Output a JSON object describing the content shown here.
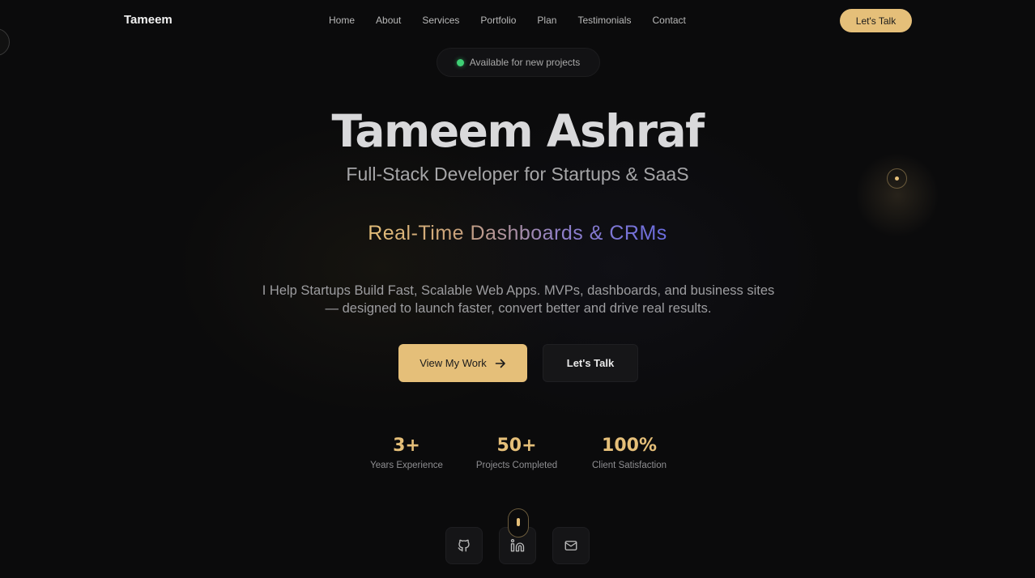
{
  "nav": {
    "brand": "Tameem",
    "links": [
      "Home",
      "About",
      "Services",
      "Portfolio",
      "Plan",
      "Testimonials",
      "Contact"
    ],
    "cta": "Let's Talk"
  },
  "availability": "Available for new projects",
  "hero": {
    "title": "Tameem Ashraf",
    "subtitle": "Full-Stack Developer for Startups & SaaS",
    "rotating_text": "Real-Time Dashboards & CRMs",
    "description": "I Help Startups Build Fast, Scalable Web Apps. MVPs, dashboards, and business sites — designed to launch faster, convert better and drive real results.",
    "primary_button": "View My Work",
    "secondary_button": "Let's Talk"
  },
  "stats": [
    {
      "value": "3+",
      "label": "Years Experience"
    },
    {
      "value": "50+",
      "label": "Projects Completed"
    },
    {
      "value": "100%",
      "label": "Client Satisfaction"
    }
  ],
  "social": [
    "github-icon",
    "linkedin-icon",
    "mail-icon"
  ],
  "colors": {
    "accent": "#e5bf79",
    "background": "#0b0b0c",
    "status_green": "#3ecf74"
  }
}
